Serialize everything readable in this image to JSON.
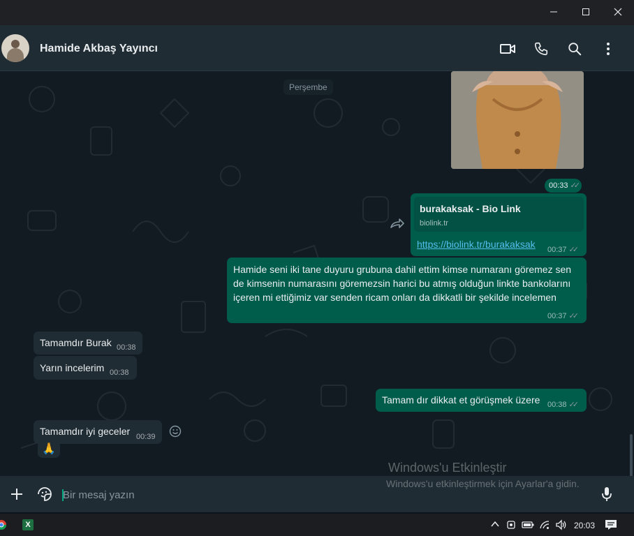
{
  "window": {
    "controls": [
      "minimize",
      "maximize",
      "close"
    ]
  },
  "header": {
    "contact_name": "Hamide Akbaş Yayıncı",
    "icons": [
      "video-call-icon",
      "voice-call-icon",
      "search-icon",
      "more-options-icon"
    ]
  },
  "chat": {
    "day_label": "Perşembe",
    "image_time": "00:33",
    "link_card": {
      "title": "burakaksak - Bio Link",
      "domain": "biolink.tr",
      "url_text": "https://biolink.tr/burakaksak",
      "time": "00:37"
    },
    "long_message": {
      "lines": [
        "Hamide seni iki tane duyuru grubuna dahil ettim kimse numaranı göremez sen",
        "de kimsenin numarasını göremezsin harici bu atmış olduğun linkte bankolarını",
        "içeren mi ettiğimiz var senden ricam onları da dikkatli bir şekilde incelemen"
      ],
      "time": "00:37"
    },
    "incoming_1": {
      "text": "Tamamdır Burak",
      "time": "00:38"
    },
    "incoming_2": {
      "text": "Yarın incelerim",
      "time": "00:38"
    },
    "outgoing_short": {
      "text": "Tamam dır dikkat et görüşmek üzere",
      "time": "00:38"
    },
    "incoming_3": {
      "text": "Tamamdır iyi geceler",
      "time": "00:39",
      "reaction": "🙏"
    }
  },
  "composer": {
    "placeholder": "Bir mesaj yazın"
  },
  "watermark": {
    "title": "Windows'u Etkinleştir",
    "subtitle": "Windows'u etkinleştirmek için Ayarlar'a gidin."
  },
  "taskbar": {
    "clock": "20:03",
    "excel_label": "X"
  },
  "colors": {
    "accent_green": "#005c4b",
    "link_color": "#53bdeb"
  }
}
